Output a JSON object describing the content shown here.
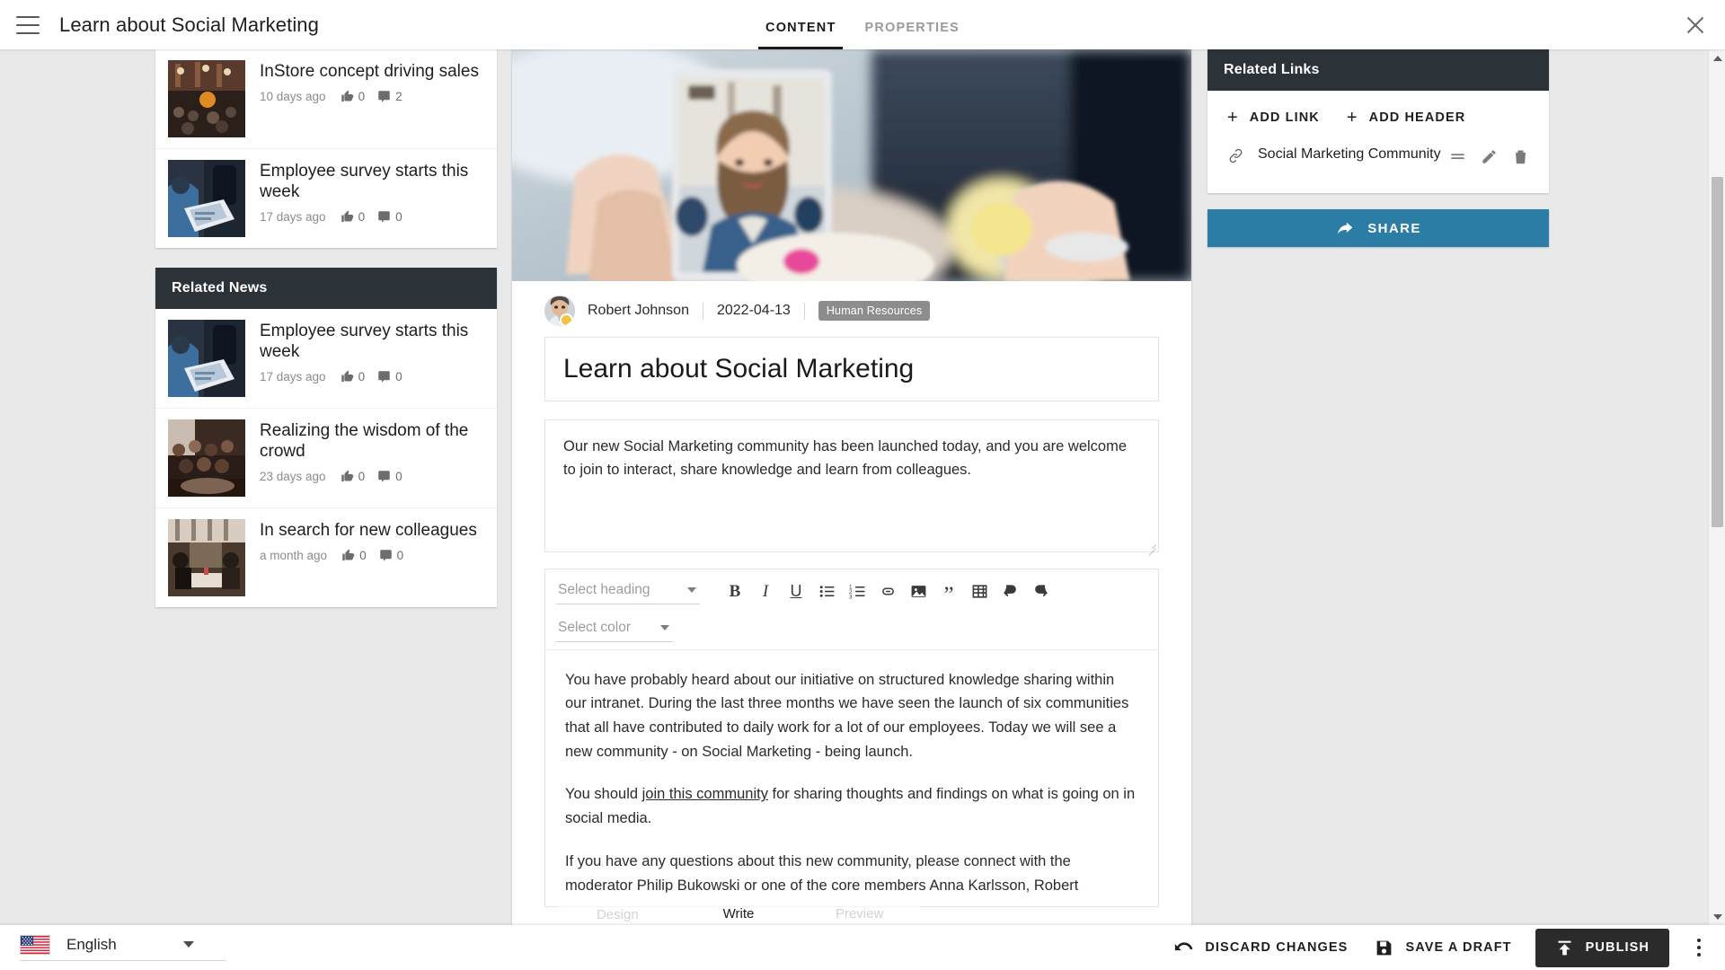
{
  "topbar": {
    "menu_icon": "hamburger-icon",
    "title": "Learn about Social Marketing",
    "tabs": [
      {
        "label": "CONTENT",
        "active": true
      },
      {
        "label": "PROPERTIES",
        "active": false
      }
    ],
    "close_icon": "close-icon"
  },
  "left_panel": {
    "top_list": {
      "items": [
        {
          "title": "InStore concept driving sales",
          "age": "10 days ago",
          "likes": "0",
          "comments": "2"
        },
        {
          "title": "Employee survey starts this week",
          "age": "17 days ago",
          "likes": "0",
          "comments": "0"
        }
      ]
    },
    "related_news": {
      "header": "Related News",
      "items": [
        {
          "title": "Employee survey starts this week",
          "age": "17 days ago",
          "likes": "0",
          "comments": "0"
        },
        {
          "title": "Realizing the wisdom of the crowd",
          "age": "23 days ago",
          "likes": "0",
          "comments": "0"
        },
        {
          "title": "In search for new colleagues",
          "age": "a month ago",
          "likes": "0",
          "comments": "0"
        }
      ]
    }
  },
  "article": {
    "author": "Robert Johnson",
    "date": "2022-04-13",
    "tag": "Human Resources",
    "title": "Learn about Social Marketing",
    "lead": "Our new Social Marketing community has been launched today, and you are welcome to join to interact, share knowledge and learn from colleagues.",
    "body": {
      "p1": "You have probably heard about our initiative on structured knowledge sharing within our intranet. During the last three months we have seen the launch of six communities that all have contributed to daily work for a lot of our employees. Today we will see a new community - on Social Marketing - being launch.",
      "p2_before": "You should ",
      "p2_link": "join this community",
      "p2_after": " for sharing thoughts and findings on what is going on in social media.",
      "p3": "If you have any questions about this new community, please connect with the moderator Philip Bukowski or one of the core members Anna Karlsson, Robert"
    }
  },
  "editor_toolbar": {
    "heading_select": "Select heading",
    "color_select": "Select color",
    "buttons": [
      {
        "name": "bold-button",
        "label": "B"
      },
      {
        "name": "italic-button",
        "label": "I"
      },
      {
        "name": "underline-button",
        "label": "U"
      },
      {
        "name": "bulleted-list-button",
        "label": ""
      },
      {
        "name": "numbered-list-button",
        "label": ""
      },
      {
        "name": "link-button",
        "label": ""
      },
      {
        "name": "image-button",
        "label": ""
      },
      {
        "name": "blockquote-button",
        "label": "”"
      },
      {
        "name": "table-button",
        "label": ""
      },
      {
        "name": "undo-button",
        "label": ""
      },
      {
        "name": "redo-button",
        "label": ""
      }
    ]
  },
  "mode_overlay": {
    "modes": [
      {
        "label": "Design",
        "active": false
      },
      {
        "label": "Write",
        "active": true
      },
      {
        "label": "Preview",
        "active": false
      }
    ]
  },
  "right_panel": {
    "header": "Related Links",
    "add_link_label": "ADD LINK",
    "add_header_label": "ADD HEADER",
    "links": [
      {
        "label": "Social Marketing Community"
      }
    ],
    "share_label": "SHARE"
  },
  "bottombar": {
    "language": "English",
    "discard_label": "DISCARD CHANGES",
    "save_draft_label": "SAVE A DRAFT",
    "publish_label": "PUBLISH",
    "more_icon": "kebab-menu-icon"
  },
  "colors": {
    "panel_header": "#2c3338",
    "share_button": "#2b7da6",
    "publish_button": "#2b2b2b",
    "tag_chip": "#8d8d8d",
    "surface": "#e9e9e9"
  }
}
